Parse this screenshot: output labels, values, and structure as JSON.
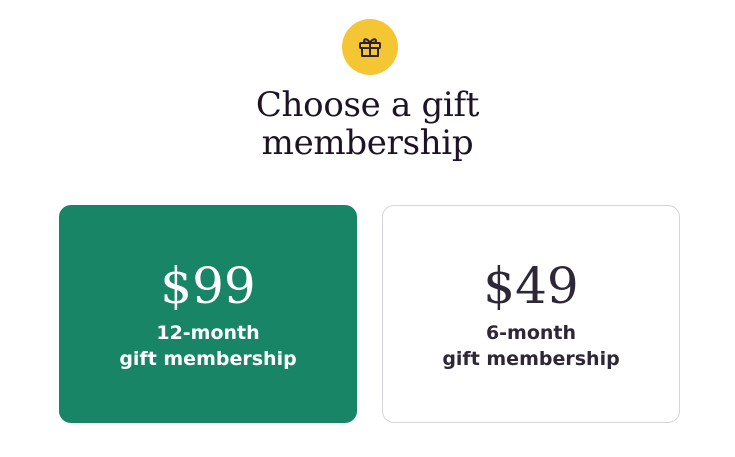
{
  "header": {
    "icon": "gift-icon",
    "icon_bg_color": "#f5c634",
    "title_line1": "Choose a gift",
    "title_line2": "membership"
  },
  "options": [
    {
      "price": "$99",
      "line1": "12-month",
      "line2": "gift membership",
      "selected": true,
      "bg_color": "#178566"
    },
    {
      "price": "$49",
      "line1": "6-month",
      "line2": "gift membership",
      "selected": false,
      "bg_color": "#ffffff"
    }
  ]
}
